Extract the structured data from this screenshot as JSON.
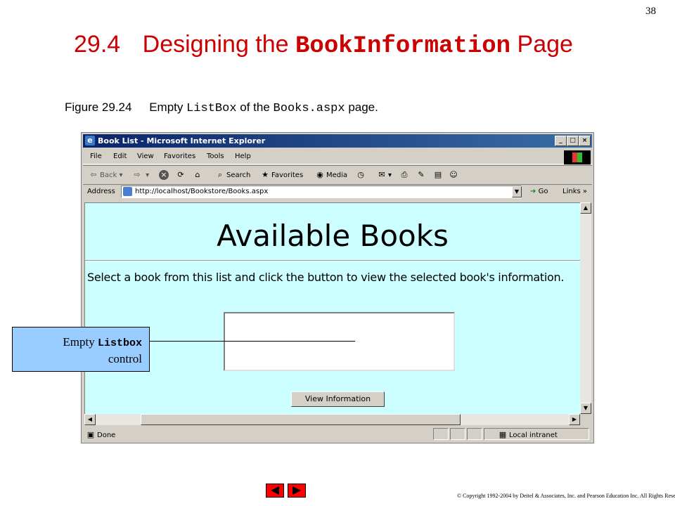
{
  "slide": {
    "page_number": "38",
    "title_number": "29.4",
    "title_pre": "Designing the",
    "title_code": "BookInformation",
    "title_post": "Page",
    "caption_fig": "Figure 29.24",
    "caption_pre": "Empty",
    "caption_code1": "ListBox",
    "caption_mid": "of the",
    "caption_code2": "Books.aspx",
    "caption_post": "page.",
    "copyright": "© Copyright 1992-2004 by Deitel & Associates, Inc. and Pearson Education Inc. All Rights Reserved."
  },
  "browser": {
    "title": "Book List - Microsoft Internet Explorer",
    "window_buttons": {
      "minimize": "_",
      "maximize": "□",
      "close": "×"
    },
    "menu": [
      "File",
      "Edit",
      "View",
      "Favorites",
      "Tools",
      "Help"
    ],
    "toolbar": {
      "back": "Back",
      "search": "Search",
      "favorites": "Favorites",
      "media": "Media"
    },
    "address_label": "Address",
    "address_value": "http://localhost/Bookstore/Books.aspx",
    "go_label": "Go",
    "links_label": "Links",
    "status_text": "Done",
    "zone_text": "Local intranet"
  },
  "page": {
    "heading": "Available Books",
    "instruction": "Select a book from this list and click the button to view the selected book's information.",
    "button_label": "View Information",
    "listbox_items": []
  },
  "callout": {
    "pre": "Empty",
    "code": "Listbox",
    "line2": "control"
  },
  "colors": {
    "title": "#cc0000",
    "content_bg": "#ccffff",
    "callout_bg": "#99ccff",
    "nav": "#ff0000"
  }
}
